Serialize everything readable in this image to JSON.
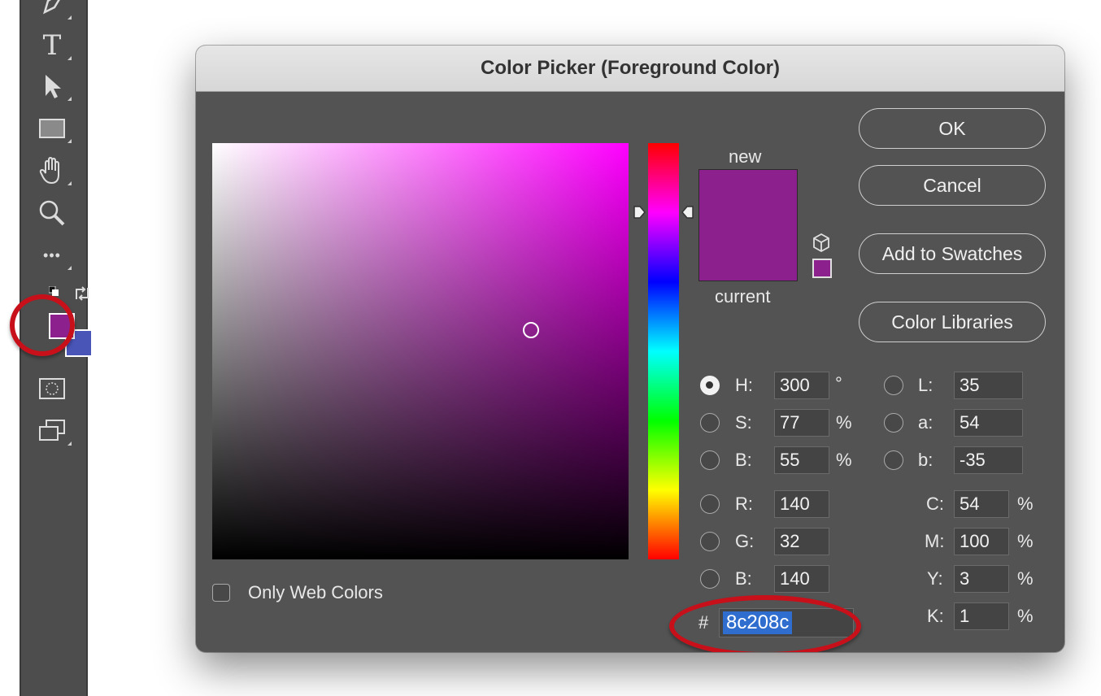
{
  "colors": {
    "current_color": "#8c208c",
    "background_swatch": "#4a55b8",
    "annotation_red": "#c8101a",
    "selection_blue": "#2f6ecf"
  },
  "toolbar": {
    "tools": [
      "pen-icon",
      "type-icon",
      "selection-arrow-icon",
      "rectangle-icon",
      "hand-icon",
      "zoom-icon",
      "more-icon",
      "quick-mask-icon",
      "screen-mode-icon"
    ],
    "type_glyph": "T",
    "more_glyph": "•••"
  },
  "dialog": {
    "title": "Color Picker (Foreground Color)",
    "new_label": "new",
    "current_label": "current",
    "buttons": {
      "ok": "OK",
      "cancel": "Cancel",
      "add_to_swatches": "Add to Swatches",
      "color_libraries": "Color Libraries"
    },
    "hsb": {
      "h_label": "H:",
      "h_value": "300",
      "h_unit": "°",
      "s_label": "S:",
      "s_value": "77",
      "s_unit": "%",
      "b_label": "B:",
      "b_value": "55",
      "b_unit": "%",
      "selected": "H"
    },
    "rgb": {
      "r_label": "R:",
      "r_value": "140",
      "g_label": "G:",
      "g_value": "32",
      "b_label": "B:",
      "b_value": "140"
    },
    "lab": {
      "l_label": "L:",
      "l_value": "35",
      "a_label": "a:",
      "a_value": "54",
      "b_label": "b:",
      "b_value": "-35"
    },
    "cmyk": {
      "c_label": "C:",
      "c_value": "54",
      "m_label": "M:",
      "m_value": "100",
      "y_label": "Y:",
      "y_value": "3",
      "k_label": "K:",
      "k_value": "1",
      "unit": "%"
    },
    "hex": {
      "prefix": "#",
      "value": "8c208c"
    },
    "only_web_colors": {
      "label": "Only Web Colors",
      "checked": false
    }
  }
}
